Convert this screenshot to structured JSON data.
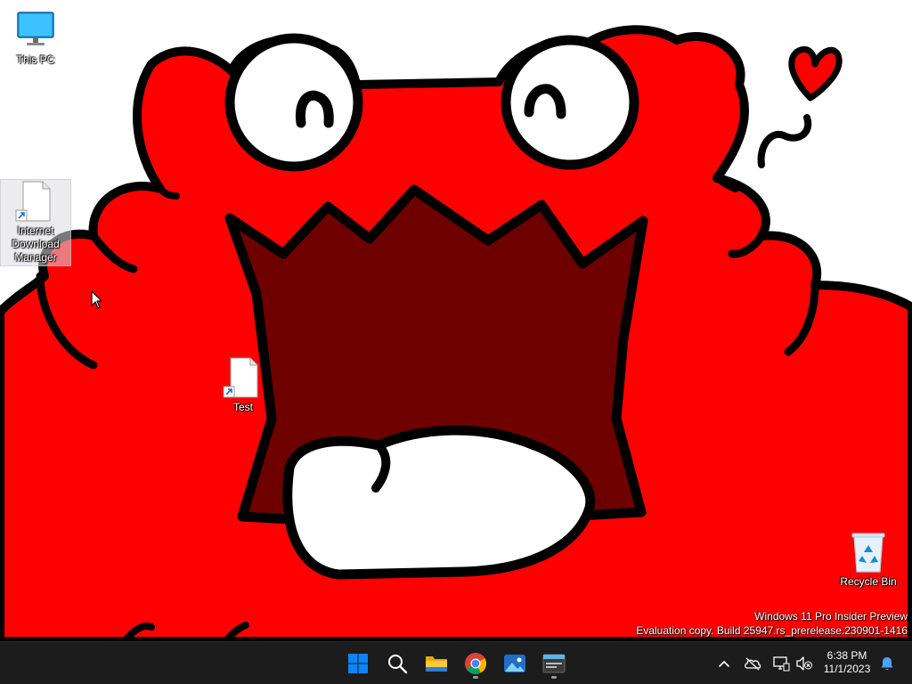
{
  "desktop": {
    "icons": [
      {
        "name": "This PC",
        "glyph": "monitor-icon"
      },
      {
        "name": "Internet Download Manager",
        "glyph": "document-shortcut-icon",
        "selected": true
      },
      {
        "name": "Test",
        "glyph": "document-shortcut-icon"
      },
      {
        "name": "Recycle Bin",
        "glyph": "recycle-bin-icon"
      }
    ],
    "watermark": {
      "line1": "Windows 11 Pro Insider Preview",
      "line2": "Evaluation copy. Build 25947.rs_prerelease.230901-1416"
    }
  },
  "taskbar": {
    "pinned": [
      {
        "name": "Start",
        "icon": "windows-start-icon"
      },
      {
        "name": "Search",
        "icon": "search-icon"
      },
      {
        "name": "File Explorer",
        "icon": "folder-icon"
      },
      {
        "name": "Google Chrome",
        "icon": "chrome-icon",
        "running": true
      },
      {
        "name": "Photos",
        "icon": "photos-icon"
      },
      {
        "name": "Terminal",
        "icon": "terminal-window-icon",
        "running": true
      }
    ],
    "tray": [
      "chevron-up-icon",
      "onedrive-offline-icon",
      "network-icon",
      "volume-muted-icon",
      "notification-bell-icon"
    ],
    "clock": {
      "time": "6:38 PM",
      "date": "11/1/2023"
    }
  },
  "colors": {
    "wallpaper_red": "#ff0000",
    "mouth": "#6e0000",
    "outline": "#000000",
    "taskbar": "#1c1c1c",
    "windows_blue": "#0a84ff"
  }
}
